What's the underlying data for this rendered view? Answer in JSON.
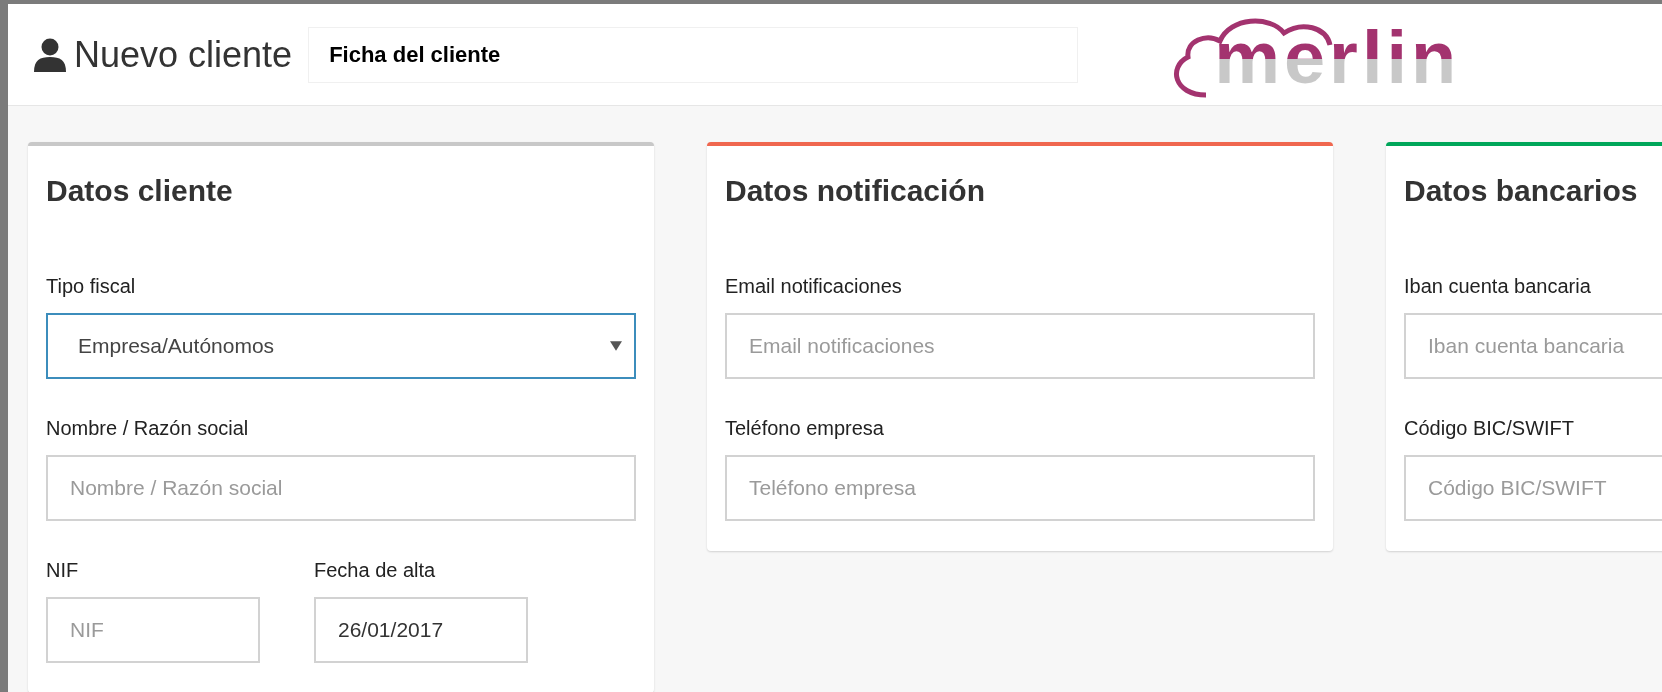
{
  "header": {
    "title": "Nuevo cliente",
    "subtitle_field": "Ficha del cliente",
    "logo": "merlin"
  },
  "cards": [
    {
      "title": "Datos cliente",
      "color": "#c8c8c8",
      "rows": [
        [
          {
            "kind": "select",
            "label": "Tipo fiscal",
            "value": "Empresa/Autónomos",
            "focused": true
          }
        ],
        [
          {
            "kind": "input",
            "label": "Nombre / Razón social",
            "placeholder": "Nombre / Razón social"
          }
        ],
        [
          {
            "kind": "input",
            "label": "NIF",
            "placeholder": "NIF"
          },
          {
            "kind": "input",
            "label": "Fecha de alta",
            "value": "26/01/2017"
          }
        ]
      ]
    },
    {
      "title": "Datos notificación",
      "color": "#f0674f",
      "rows": [
        [
          {
            "kind": "input",
            "label": "Email notificaciones",
            "placeholder": "Email notificaciones"
          }
        ],
        [
          {
            "kind": "input",
            "label": "Teléfono empresa",
            "placeholder": "Teléfono empresa"
          }
        ]
      ]
    },
    {
      "title": "Datos bancarios",
      "color": "#00a65a",
      "rows": [
        [
          {
            "kind": "input",
            "label": "Iban cuenta bancaria",
            "placeholder": "Iban cuenta bancaria"
          }
        ],
        [
          {
            "kind": "input",
            "label": "Código BIC/SWIFT",
            "placeholder": "Código BIC/SWIFT"
          }
        ]
      ]
    }
  ]
}
